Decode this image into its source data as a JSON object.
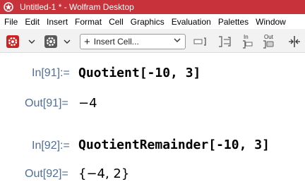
{
  "window": {
    "title": "Untitled-1 * - Wolfram Desktop"
  },
  "menu": [
    "File",
    "Edit",
    "Insert",
    "Format",
    "Cell",
    "Graphics",
    "Evaluation",
    "Palettes",
    "Window"
  ],
  "toolbar": {
    "insert_cell_label": "Insert Cell...",
    "input_btn_label": "In",
    "output_btn_label": "Out"
  },
  "cells": [
    {
      "in_label": "In[91]:=",
      "input": "Quotient[-10, 3]",
      "out_label": "Out[91]=",
      "output": "−4"
    },
    {
      "in_label": "In[92]:=",
      "input": "QuotientRemainder[-10, 3]",
      "out_label": "Out[92]=",
      "output": "{−4, 2}"
    }
  ],
  "colors": {
    "titlebar": "#c8323a",
    "cell_label": "#4f6f96",
    "toolbar_red": "#cc2222"
  }
}
